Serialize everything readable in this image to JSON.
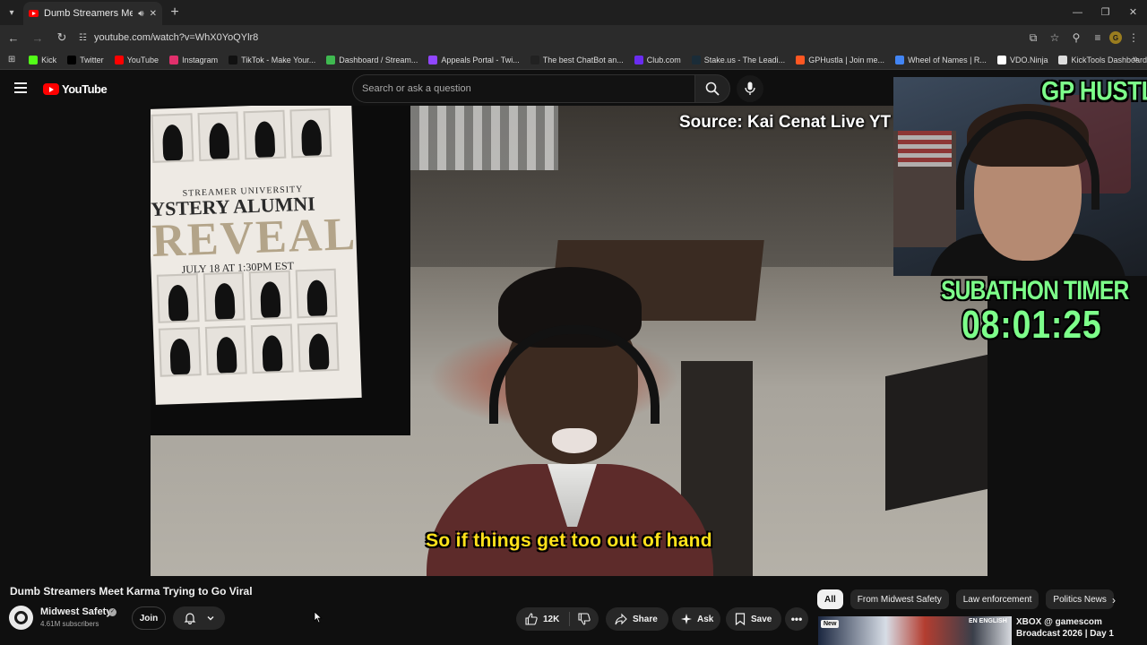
{
  "browser": {
    "tab_title": "Dumb Streamers Meet Karma Trying to Go Viral - YouTube",
    "url": "youtube.com/watch?v=WhX0YoQYlr8",
    "bookmarks": [
      {
        "label": "Kick",
        "color": "#53fc18"
      },
      {
        "label": "Twitter",
        "color": "#000000"
      },
      {
        "label": "YouTube",
        "color": "#ff0000"
      },
      {
        "label": "Instagram",
        "color": "#e1306c"
      },
      {
        "label": "TikTok - Make Your...",
        "color": "#111111"
      },
      {
        "label": "Dashboard / Stream...",
        "color": "#3fb950"
      },
      {
        "label": "Appeals Portal - Twi...",
        "color": "#9146ff"
      },
      {
        "label": "The best ChatBot an...",
        "color": "#222222"
      },
      {
        "label": "Club.com",
        "color": "#6a2cf0"
      },
      {
        "label": "Stake.us - The Leadi...",
        "color": "#1a2c38"
      },
      {
        "label": "GPHustla | Join me...",
        "color": "#ff5722"
      },
      {
        "label": "Wheel of Names | R...",
        "color": "#4285f4"
      },
      {
        "label": "VDO.Ninja",
        "color": "#ffffff"
      },
      {
        "label": "KickTools Dashboard",
        "color": "#dddddd"
      }
    ]
  },
  "youtube": {
    "logo_text": "YouTube",
    "search_placeholder": "Search or ask a question"
  },
  "video": {
    "poster_sub": "STREAMER UNIVERSITY",
    "poster_title": "YSTERY ALUMNI",
    "poster_reveal": "REVEAL",
    "poster_date": "JULY 18 AT 1:30PM EST",
    "source_label": "Source: Kai Cenat Live YT",
    "caption": "So if things get too out of hand",
    "overlay_name": "GP HUSTLA",
    "overlay_timer_label": "SUBATHON TIMER",
    "overlay_timer": "08:01:25"
  },
  "details": {
    "title": "Dumb Streamers Meet Karma Trying to Go Viral",
    "channel": "Midwest Safety",
    "subscribers": "4.61M subscribers",
    "join_label": "Join",
    "likes": "12K",
    "share_label": "Share",
    "ask_label": "Ask",
    "save_label": "Save"
  },
  "sidebar": {
    "chips": [
      "All",
      "From Midwest Safety",
      "Law enforcement",
      "Politics News"
    ],
    "rec_badge": "New",
    "rec_lang": "EN ENGLISH",
    "rec_title": "XBOX @ gamescom Broadcast 2026 | Day 1"
  }
}
